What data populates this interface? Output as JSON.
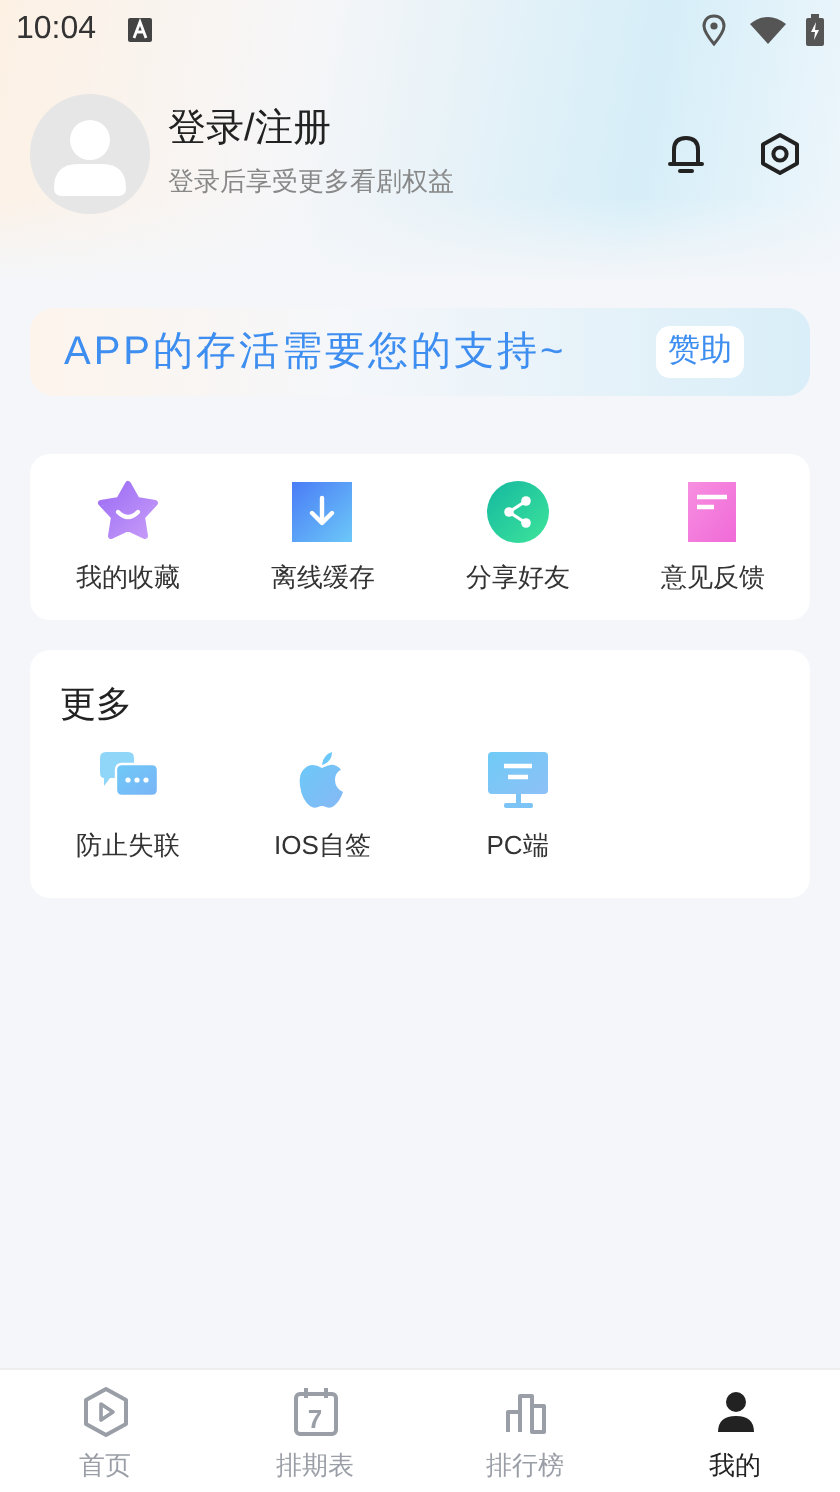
{
  "status_bar": {
    "time": "10:04"
  },
  "profile": {
    "title": "登录/注册",
    "subtitle": "登录后享受更多看剧权益"
  },
  "banner": {
    "text": "APP的存活需要您的支持~",
    "button": "赞助"
  },
  "shortcuts": [
    {
      "kind": "star",
      "label": "我的收藏"
    },
    {
      "kind": "download",
      "label": "离线缓存"
    },
    {
      "kind": "share",
      "label": "分享好友"
    },
    {
      "kind": "feedback",
      "label": "意见反馈"
    }
  ],
  "more": {
    "title": "更多",
    "items": [
      {
        "kind": "chat",
        "label": "防止失联"
      },
      {
        "kind": "apple",
        "label": "IOS自签"
      },
      {
        "kind": "monitor",
        "label": "PC端"
      }
    ]
  },
  "tab_bar": [
    {
      "kind": "home",
      "label": "首页",
      "selected": false
    },
    {
      "kind": "calendar",
      "label": "排期表",
      "icon_text": "7",
      "selected": false
    },
    {
      "kind": "ranking",
      "label": "排行榜",
      "selected": false
    },
    {
      "kind": "me",
      "label": "我的",
      "selected": true
    }
  ]
}
